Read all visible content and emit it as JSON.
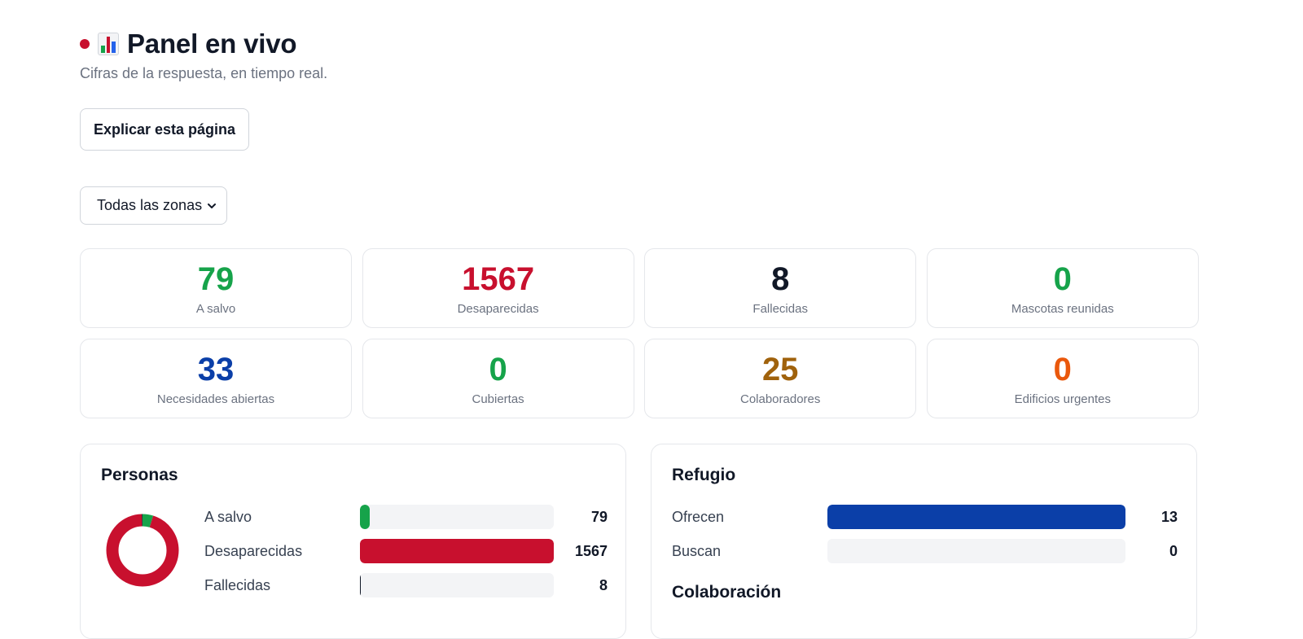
{
  "header": {
    "title": "Panel en vivo",
    "subtitle": "Cifras de la respuesta, en tiempo real.",
    "live_color": "#c8102e",
    "title_icon": "bar-chart-emoji"
  },
  "actions": {
    "explain_label": "Explicar esta página"
  },
  "filter": {
    "zone_selected": "Todas las zonas"
  },
  "stats": [
    {
      "value": "79",
      "label": "A salvo",
      "color": "#16a34a"
    },
    {
      "value": "1567",
      "label": "Desaparecidas",
      "color": "#c8102e"
    },
    {
      "value": "8",
      "label": "Fallecidas",
      "color": "#111827"
    },
    {
      "value": "0",
      "label": "Mascotas reunidas",
      "color": "#16a34a"
    },
    {
      "value": "33",
      "label": "Necesidades abiertas",
      "color": "#0b3fa8"
    },
    {
      "value": "0",
      "label": "Cubiertas",
      "color": "#16a34a"
    },
    {
      "value": "25",
      "label": "Colaboradores",
      "color": "#a0620c"
    },
    {
      "value": "0",
      "label": "Edificios urgentes",
      "color": "#ea580c"
    }
  ],
  "personas": {
    "title": "Personas",
    "rows": [
      {
        "label": "A salvo",
        "value": 79,
        "display": "79",
        "color": "#16a34a"
      },
      {
        "label": "Desaparecidas",
        "value": 1567,
        "display": "1567",
        "color": "#c8102e"
      },
      {
        "label": "Fallecidas",
        "value": 8,
        "display": "8",
        "color": "#111827"
      }
    ]
  },
  "refugio": {
    "title": "Refugio",
    "rows": [
      {
        "label": "Ofrecen",
        "value": 13,
        "display": "13",
        "color": "#0b3fa8"
      },
      {
        "label": "Buscan",
        "value": 0,
        "display": "0",
        "color": "#0b3fa8"
      }
    ]
  },
  "colaboracion": {
    "title": "Colaboración"
  }
}
